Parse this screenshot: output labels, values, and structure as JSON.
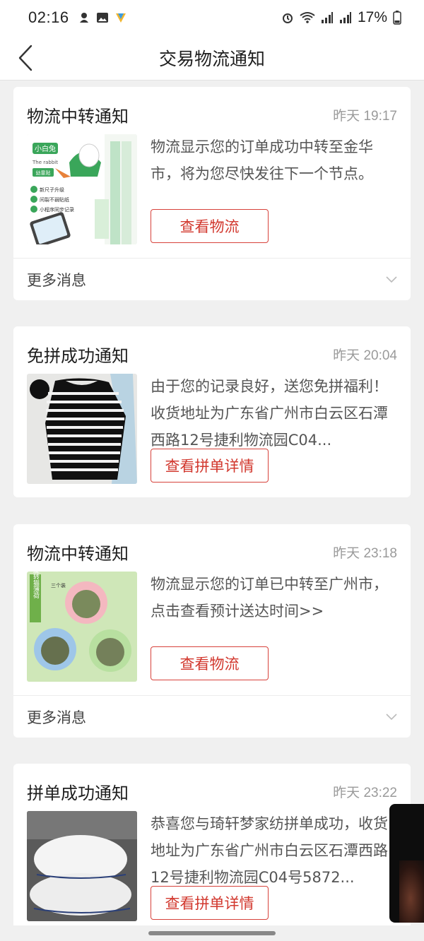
{
  "status": {
    "time": "02:16",
    "battery": "17%"
  },
  "header": {
    "title": "交易物流通知"
  },
  "cards": [
    {
      "title": "物流中转通知",
      "time": "昨天 19:17",
      "message": "物流显示您的订单成功中转至金华市，将为您尽快发往下一个节点。",
      "button": "查看物流",
      "more": "更多消息",
      "image": "product-thumbnail-height-chart",
      "thumb_text": {
        "brand": "小白兔",
        "sub": "The rabbit",
        "tag": "幼童贴",
        "features": [
          "新尺子升级",
          "间裂不弱贴纸",
          "小程序同步记录"
        ]
      }
    },
    {
      "title": "免拼成功通知",
      "time": "昨天 20:04",
      "message": "由于您的记录良好，送您免拼福利！收货地址为广东省广州市白云区石潭西路12号捷利物流园C04...",
      "button": "查看拼单详情",
      "image": "product-thumbnail-striped-shirt"
    },
    {
      "title": "物流中转通知",
      "time": "昨天 23:18",
      "message": "物流显示您的订单已中转至广州市，点击查看预计送达时间>>",
      "button": "查看物流",
      "more": "更多消息",
      "image": "product-thumbnail-cat-mint-balls",
      "thumb_text": {
        "side": "旋转猫薄荷",
        "badge": "三个装"
      }
    },
    {
      "title": "拼单成功通知",
      "time": "昨天 23:22",
      "message": "恭喜您与琦轩梦家纺拼单成功，收货地址为广东省广州市白云区石潭西路12号捷利物流园C04号5872...",
      "button": "查看拼单详情",
      "image": "product-thumbnail-pillows"
    }
  ],
  "colors": {
    "accent": "#d2382e",
    "background": "#f0f0f0",
    "card": "#ffffff",
    "muted": "#9a9a9a"
  }
}
